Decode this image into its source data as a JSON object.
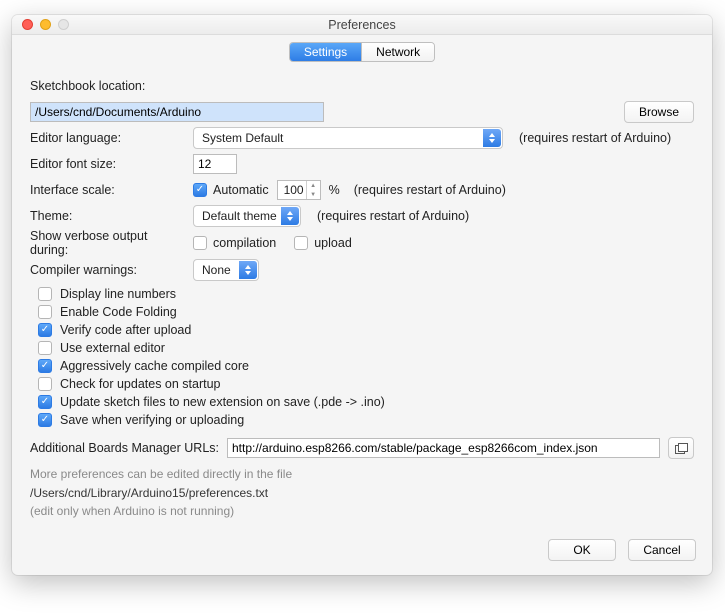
{
  "title": "Preferences",
  "tabs": {
    "settings": "Settings",
    "network": "Network"
  },
  "sketchbook": {
    "label": "Sketchbook location:",
    "path": "/Users/cnd/Documents/Arduino",
    "browse": "Browse"
  },
  "editorLanguage": {
    "label": "Editor language:",
    "value": "System Default",
    "hint": "(requires restart of Arduino)"
  },
  "editorFont": {
    "label": "Editor font size:",
    "value": "12"
  },
  "interfaceScale": {
    "label": "Interface scale:",
    "auto": "Automatic",
    "value": "100",
    "pct": "%",
    "hint": "(requires restart of Arduino)"
  },
  "theme": {
    "label": "Theme:",
    "value": "Default theme",
    "hint": "(requires restart of Arduino)"
  },
  "verbose": {
    "label": "Show verbose output during:",
    "compile": "compilation",
    "upload": "upload"
  },
  "compilerWarnings": {
    "label": "Compiler warnings:",
    "value": "None"
  },
  "options": {
    "displayLineNumbers": "Display line numbers",
    "enableCodeFolding": "Enable Code Folding",
    "verifyAfterUpload": "Verify code after upload",
    "useExternalEditor": "Use external editor",
    "aggressiveCache": "Aggressively cache compiled core",
    "checkUpdates": "Check for updates on startup",
    "updateSketchFiles": "Update sketch files to new extension on save (.pde -> .ino)",
    "saveWhenVerify": "Save when verifying or uploading"
  },
  "boardsUrl": {
    "label": "Additional Boards Manager URLs:",
    "value": "http://arduino.esp8266.com/stable/package_esp8266com_index.json"
  },
  "footer": {
    "line1": "More preferences can be edited directly in the file",
    "path": "/Users/cnd/Library/Arduino15/preferences.txt",
    "line3": "(edit only when Arduino is not running)"
  },
  "buttons": {
    "ok": "OK",
    "cancel": "Cancel"
  }
}
